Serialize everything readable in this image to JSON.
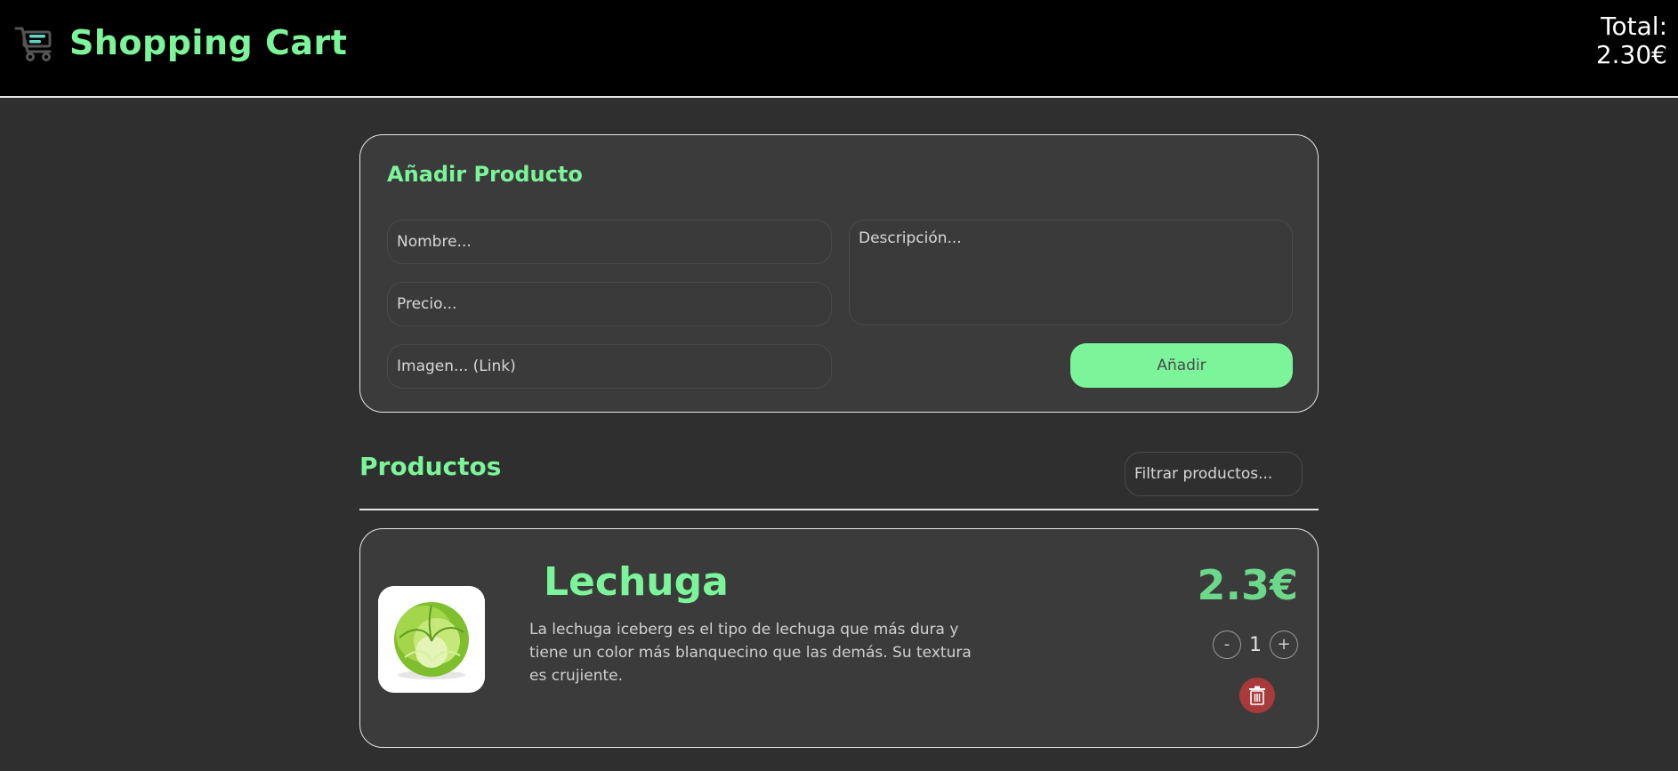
{
  "header": {
    "title": "Shopping Cart",
    "cart_icon": "shopping-cart-icon",
    "total_label": "Total:",
    "total_value": "2.30€"
  },
  "add_product": {
    "title": "Añadir Producto",
    "name_placeholder": "Nombre...",
    "price_placeholder": "Precio...",
    "image_placeholder": "Imagen... (Link)",
    "description_placeholder": "Descripción...",
    "add_label": "Añadir"
  },
  "products": {
    "title": "Productos",
    "filter_placeholder": "Filtrar productos...",
    "items": [
      {
        "name": "Lechuga",
        "description": "La lechuga iceberg es el tipo de lechuga que más dura y tiene un color más blanquecino que las demás. Su textura es crujiente.",
        "price": "2.3€",
        "quantity": "1",
        "minus_label": "-",
        "plus_label": "+",
        "image": "lettuce-image",
        "delete_icon": "trash-icon"
      }
    ]
  },
  "colors": {
    "accent": "#7cf59a",
    "header_bg": "#000000",
    "page_bg": "#2f2f2f",
    "panel_bg": "#3b3b3b",
    "delete": "#a93a3a"
  }
}
